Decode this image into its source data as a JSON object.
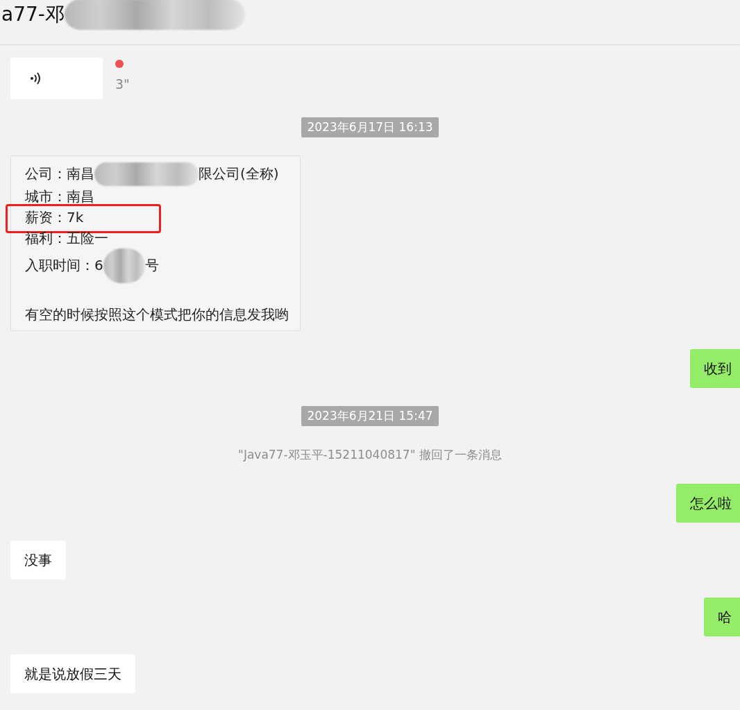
{
  "window": {
    "title": "a77-邓",
    "title_redacted": true
  },
  "messages": [
    {
      "kind": "voice",
      "outgoing": false,
      "duration": "3\"",
      "unread": true
    },
    {
      "kind": "time",
      "text": "2023年6月17日 16:13"
    },
    {
      "kind": "card",
      "outgoing": false,
      "lines": [
        {
          "highlighted": false,
          "parts": [
            {
              "kind": "text",
              "text": "公司：南昌"
            },
            {
              "kind": "redacted"
            },
            {
              "kind": "text",
              "text": "限公司(全称)"
            }
          ]
        },
        {
          "highlighted": false,
          "parts": [
            {
              "kind": "text",
              "text": "城市：南昌"
            }
          ]
        },
        {
          "highlighted": true,
          "parts": [
            {
              "kind": "text",
              "text": "薪资：7k"
            }
          ]
        },
        {
          "highlighted": false,
          "parts": [
            {
              "kind": "text",
              "text": "福利：五险一"
            }
          ]
        },
        {
          "highlighted": false,
          "parts": [
            {
              "kind": "text",
              "text": "入职时间：6"
            },
            {
              "kind": "redacted"
            },
            {
              "kind": "text",
              "text": "号"
            }
          ]
        },
        {
          "highlighted": false
        },
        {
          "highlighted": false,
          "parts": [
            {
              "kind": "text",
              "text": "有空的时候按照这个模式把你的信息发我哟"
            }
          ]
        }
      ]
    },
    {
      "kind": "text",
      "outgoing": true,
      "text": "收到"
    },
    {
      "kind": "time",
      "text": "2023年6月21日 15:47"
    },
    {
      "kind": "notice",
      "text": "\"Java77-邓玉平-15211040817\" 撤回了一条消息"
    },
    {
      "kind": "text",
      "outgoing": true,
      "text": "怎么啦"
    },
    {
      "kind": "text",
      "outgoing": false,
      "text": "没事"
    },
    {
      "kind": "text",
      "outgoing": true,
      "text": "哈"
    },
    {
      "kind": "text",
      "outgoing": false,
      "text": "就是说放假三天"
    }
  ]
}
